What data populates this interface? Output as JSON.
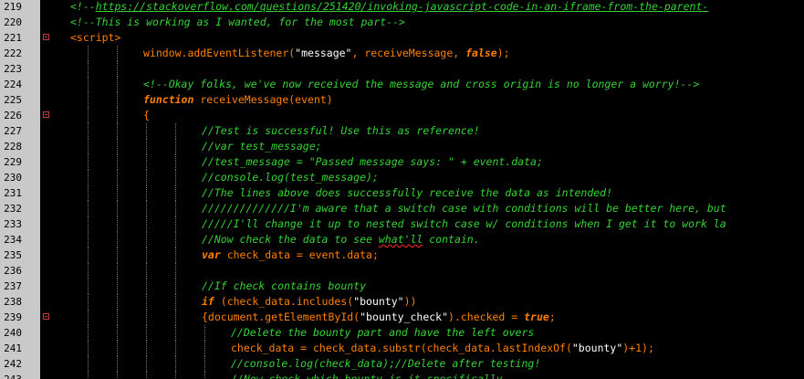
{
  "lines": [
    {
      "num": "219",
      "fold": false,
      "indent": 0,
      "guides": [],
      "segments": [
        [
          "c-comment",
          "<!--"
        ],
        [
          "c-link",
          "https://stackoverflow.com/questions/251420/invoking-javascript-code-in-an-iframe-from-the-parent-"
        ]
      ]
    },
    {
      "num": "220",
      "fold": false,
      "indent": 0,
      "guides": [],
      "segments": [
        [
          "c-comment",
          "<!--This is working as I wanted, for the most part-->"
        ]
      ]
    },
    {
      "num": "221",
      "fold": true,
      "indent": 0,
      "guides": [],
      "segments": [
        [
          "c-tag",
          "<script>"
        ]
      ]
    },
    {
      "num": "222",
      "fold": false,
      "indent": 80,
      "guides": [
        96,
        128
      ],
      "segments": [
        [
          "c-plain",
          "window.addEventListener("
        ],
        [
          "c-str",
          "\"message\""
        ],
        [
          "c-plain",
          ", receiveMessage, "
        ],
        [
          "c-kw",
          "false"
        ],
        [
          "c-plain",
          ");"
        ]
      ]
    },
    {
      "num": "223",
      "fold": false,
      "indent": 0,
      "guides": [
        96,
        128
      ],
      "segments": []
    },
    {
      "num": "224",
      "fold": false,
      "indent": 80,
      "guides": [
        96,
        128
      ],
      "segments": [
        [
          "c-comment",
          "<!--Okay folks, we've now received the message and cross origin is no longer a worry!-->"
        ]
      ]
    },
    {
      "num": "225",
      "fold": false,
      "indent": 80,
      "guides": [
        96,
        128
      ],
      "segments": [
        [
          "c-kw",
          "function"
        ],
        [
          "c-plain",
          " receiveMessage(event)"
        ]
      ]
    },
    {
      "num": "226",
      "fold": true,
      "indent": 80,
      "guides": [
        96,
        128
      ],
      "segments": [
        [
          "c-plain",
          "{"
        ]
      ]
    },
    {
      "num": "227",
      "fold": false,
      "indent": 144,
      "guides": [
        96,
        128,
        160,
        192
      ],
      "segments": [
        [
          "c-comment",
          "//Test is successful! Use this as reference!"
        ]
      ]
    },
    {
      "num": "228",
      "fold": false,
      "indent": 144,
      "guides": [
        96,
        128,
        160,
        192
      ],
      "segments": [
        [
          "c-comment",
          "//var test_message;"
        ]
      ]
    },
    {
      "num": "229",
      "fold": false,
      "indent": 144,
      "guides": [
        96,
        128,
        160,
        192
      ],
      "segments": [
        [
          "c-comment",
          "//test_message = \"Passed message says: \" + event.data;"
        ]
      ]
    },
    {
      "num": "230",
      "fold": false,
      "indent": 144,
      "guides": [
        96,
        128,
        160,
        192
      ],
      "segments": [
        [
          "c-comment",
          "//console.log(test_message);"
        ]
      ]
    },
    {
      "num": "231",
      "fold": false,
      "indent": 144,
      "guides": [
        96,
        128,
        160,
        192
      ],
      "segments": [
        [
          "c-comment",
          "//The lines above does successfully receive the data as intended!"
        ]
      ]
    },
    {
      "num": "232",
      "fold": false,
      "indent": 144,
      "guides": [
        96,
        128,
        160,
        192
      ],
      "segments": [
        [
          "c-comment",
          "//////////////I'm aware that a switch case with conditions will be better here, but"
        ]
      ]
    },
    {
      "num": "233",
      "fold": false,
      "indent": 144,
      "guides": [
        96,
        128,
        160,
        192
      ],
      "segments": [
        [
          "c-comment",
          "/////I'll change it up to nested switch case w/ conditions when I get it to work la"
        ]
      ]
    },
    {
      "num": "234",
      "fold": false,
      "indent": 144,
      "guides": [
        96,
        128,
        160,
        192
      ],
      "segments": [
        [
          "c-comment",
          "//Now check the data to see "
        ],
        [
          "c-comment c-wavy",
          "what'll"
        ],
        [
          "c-comment",
          " contain."
        ]
      ]
    },
    {
      "num": "235",
      "fold": false,
      "indent": 144,
      "guides": [
        96,
        128,
        160,
        192
      ],
      "segments": [
        [
          "c-kw",
          "var"
        ],
        [
          "c-plain",
          " check_data = event.data;"
        ]
      ]
    },
    {
      "num": "236",
      "fold": false,
      "indent": 0,
      "guides": [
        96,
        128,
        160,
        192
      ],
      "segments": []
    },
    {
      "num": "237",
      "fold": false,
      "indent": 144,
      "guides": [
        96,
        128,
        160,
        192
      ],
      "segments": [
        [
          "c-comment",
          "//If check contains bounty"
        ]
      ]
    },
    {
      "num": "238",
      "fold": false,
      "indent": 144,
      "guides": [
        96,
        128,
        160,
        192
      ],
      "segments": [
        [
          "c-kw",
          "if"
        ],
        [
          "c-plain",
          " (check_data.includes("
        ],
        [
          "c-str",
          "\"bounty\""
        ],
        [
          "c-plain",
          "))"
        ]
      ]
    },
    {
      "num": "239",
      "fold": true,
      "indent": 144,
      "guides": [
        96,
        128,
        160,
        192
      ],
      "segments": [
        [
          "c-plain",
          "{document.getElementById("
        ],
        [
          "c-str",
          "\"bounty_check\""
        ],
        [
          "c-plain",
          ").checked = "
        ],
        [
          "c-kw",
          "true"
        ],
        [
          "c-plain",
          ";"
        ]
      ]
    },
    {
      "num": "240",
      "fold": false,
      "indent": 176,
      "guides": [
        96,
        128,
        160,
        192,
        224
      ],
      "segments": [
        [
          "c-comment",
          "//Delete the bounty part and have the left overs"
        ]
      ]
    },
    {
      "num": "241",
      "fold": false,
      "indent": 176,
      "guides": [
        96,
        128,
        160,
        192,
        224
      ],
      "segments": [
        [
          "c-plain",
          "check_data = check_data.substr(check_data.lastIndexOf("
        ],
        [
          "c-str",
          "\"bounty\""
        ],
        [
          "c-plain",
          ")+1);"
        ]
      ]
    },
    {
      "num": "242",
      "fold": false,
      "indent": 176,
      "guides": [
        96,
        128,
        160,
        192,
        224
      ],
      "segments": [
        [
          "c-comment",
          "//console.log(check_data);//Delete after testing!"
        ]
      ]
    },
    {
      "num": "243",
      "fold": false,
      "indent": 176,
      "guides": [
        96,
        128,
        160,
        192,
        224
      ],
      "segments": [
        [
          "c-comment",
          "//Now check which bounty is it specifically"
        ]
      ]
    }
  ]
}
